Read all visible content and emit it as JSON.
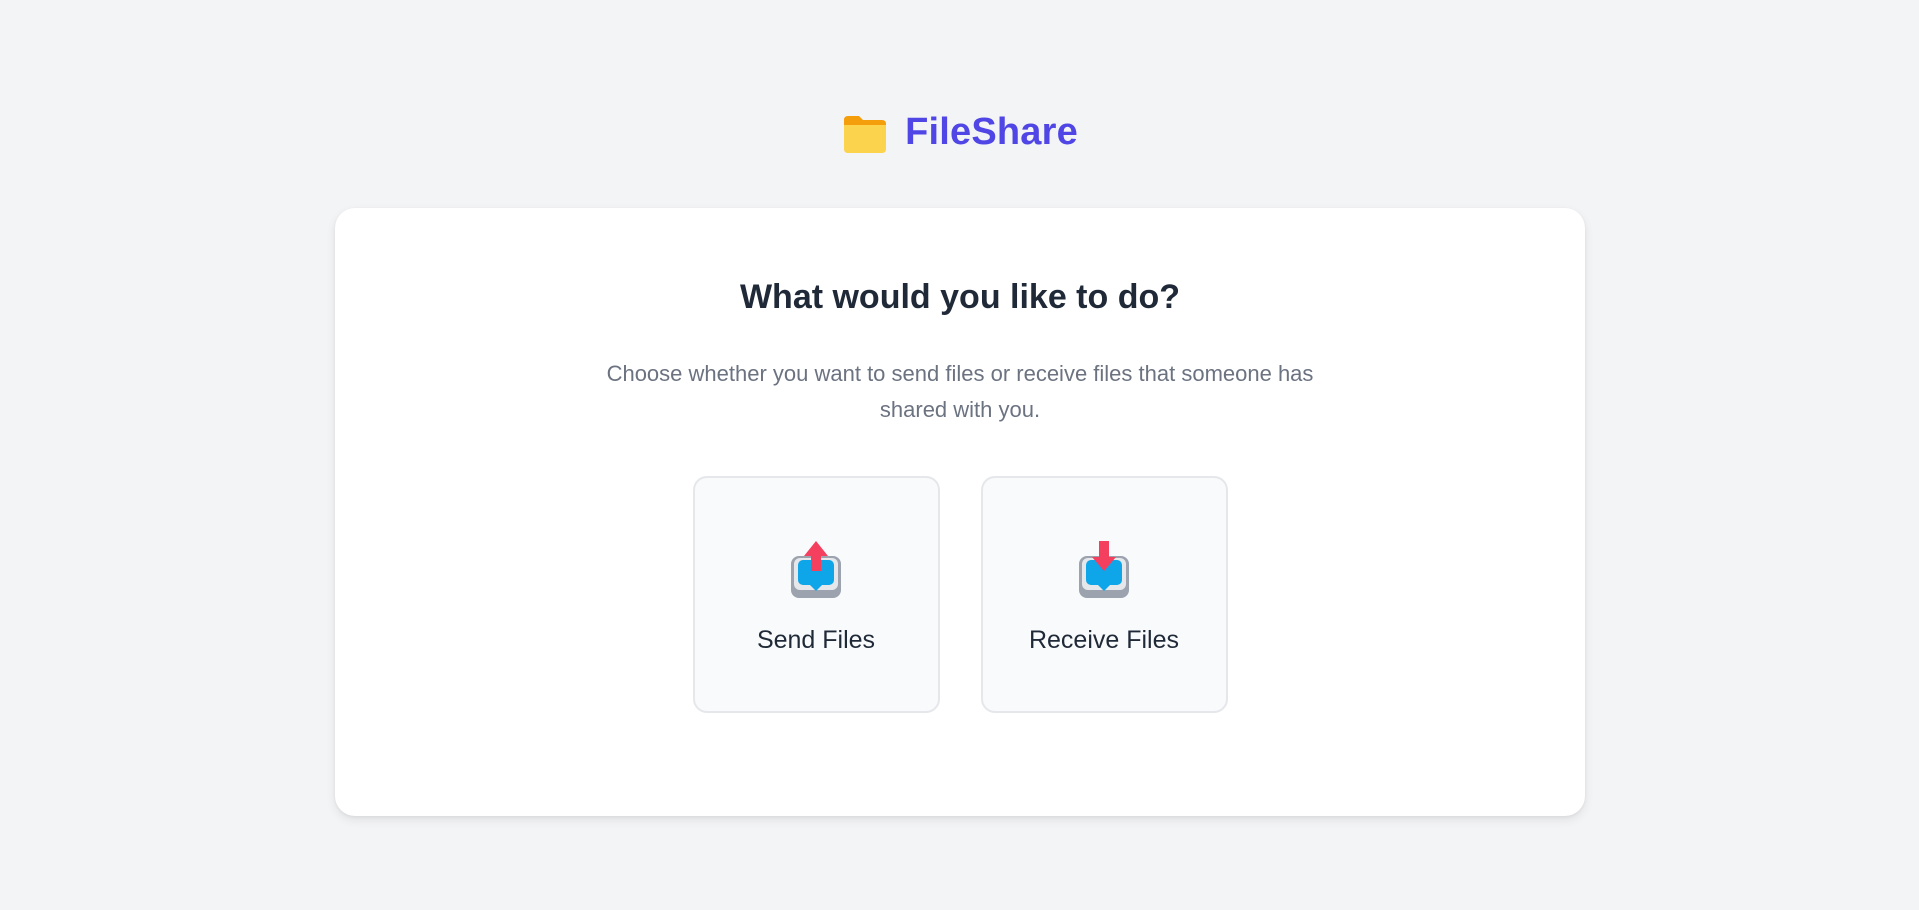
{
  "brand": {
    "icon": "folder-icon",
    "title": "FileShare",
    "color": "#4f46e5"
  },
  "main": {
    "heading": "What would you like to do?",
    "description": "Choose whether you want to send files or receive files that someone has shared with you.",
    "options": [
      {
        "label": "Send Files",
        "icon": "outbox-upload-icon"
      },
      {
        "label": "Receive Files",
        "icon": "inbox-download-icon"
      }
    ]
  },
  "colors": {
    "background": "#f3f4f6",
    "card": "#ffffff",
    "heading": "#1f2937",
    "muted_text": "#6b7280",
    "arrow": "#f43f5e",
    "tray_blue": "#0ea5e9",
    "folder": "#fcd34d"
  }
}
